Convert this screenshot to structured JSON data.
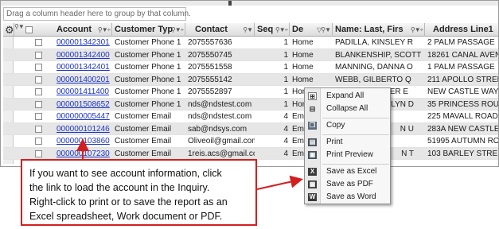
{
  "group_bar": {
    "placeholder": "Drag a column header here to group by that column."
  },
  "columns": [
    {
      "label": "Account",
      "icons": "⚲▼÷"
    },
    {
      "label": "Customer Typ",
      "icons": "⚲▼÷"
    },
    {
      "label": "Contact",
      "icons": "⚲▼"
    },
    {
      "label": "Seq",
      "icons": "⚲▼÷"
    },
    {
      "label": "De",
      "icons": "▽⚲▼"
    },
    {
      "label": "Name: Last, Firs",
      "icons": "⚲▼÷"
    },
    {
      "label": "Address Line1",
      "icons": ""
    }
  ],
  "rows": [
    {
      "account": "000001342301",
      "type": "Customer Phone 1",
      "contact": "2075557636",
      "seq": "1",
      "desc": "Home",
      "name": "PADILLA, KINSLEY R",
      "address": "2 PALM PASSAGE"
    },
    {
      "account": "000001342400",
      "type": "Customer Phone 1",
      "contact": "2075550745",
      "seq": "1",
      "desc": "Home",
      "name": "BLANKENSHIP, SCOTT",
      "address": "18261 CANAL AVENU"
    },
    {
      "account": "000001342401",
      "type": "Customer Phone 1",
      "contact": "2075551558",
      "seq": "1",
      "desc": "Home",
      "name": "MANNING, DANNA O",
      "address": "1 PALM PASSAGE"
    },
    {
      "account": "000001400201",
      "type": "Customer Phone 1",
      "contact": "2075555142",
      "seq": "1",
      "desc": "Home",
      "name": "WEBB, GILBERTO Q",
      "address": "211 APOLLO STREET"
    },
    {
      "account": "000001411400",
      "type": "Customer Phone 1",
      "contact": "2075552897",
      "seq": "1",
      "desc": "Home",
      "name": "GLOVER, ZAVIER E",
      "address": "NEW CASTLE WAY"
    },
    {
      "account": "000001508652",
      "type": "Customer Phone 1",
      "contact": "nds@ndstest.com",
      "seq": "1",
      "desc": "Home",
      "name": "LYN D",
      "address": "35 PRINCESS ROUTE"
    },
    {
      "account": "000000005447",
      "type": "Customer Email",
      "contact": "nds@ndstest.com",
      "seq": "4",
      "desc": "Em",
      "name": "",
      "address": "225 MAVALL ROAD"
    },
    {
      "account": "000000101246",
      "type": "Customer Email",
      "contact": "sab@ndsys.com",
      "seq": "4",
      "desc": "Em",
      "name": "N U",
      "address": "283A NEW CASTLE W"
    },
    {
      "account": "000000103860",
      "type": "Customer Email",
      "contact": "Oliveoil@gmail.com",
      "seq": "4",
      "desc": "Em",
      "name": "",
      "address": "51995 AUTUMN ROUT"
    },
    {
      "account": "000000107230",
      "type": "Customer Email",
      "contact": "1reis.acs@gmail.co",
      "seq": "4",
      "desc": "Em",
      "name": "N T",
      "address": "103 BARLEY STREET"
    }
  ],
  "context_menu": {
    "items": [
      {
        "label": "Expand All",
        "icon": "expand-icon"
      },
      {
        "label": "Collapse All",
        "icon": "collapse-icon"
      },
      {
        "label": "Copy",
        "icon": "copy-icon"
      },
      {
        "label": "Print",
        "icon": "print-icon"
      },
      {
        "label": "Print Preview",
        "icon": "print-preview-icon"
      },
      {
        "label": "Save as Excel",
        "icon": "excel-icon"
      },
      {
        "label": "Save as PDF",
        "icon": "pdf-icon"
      },
      {
        "label": "Save as Word",
        "icon": "word-icon"
      }
    ]
  },
  "callout": {
    "lines": [
      "If you want to see account information, click",
      "the link to load the account in the Inquiry.",
      "Right-click to print or to save the report as an",
      "Excel spreadsheet, Work document or PDF."
    ]
  },
  "colors": {
    "link": "#1a33c8",
    "callout_border": "#d21f1f",
    "alt_row": "#e6e6e6"
  }
}
